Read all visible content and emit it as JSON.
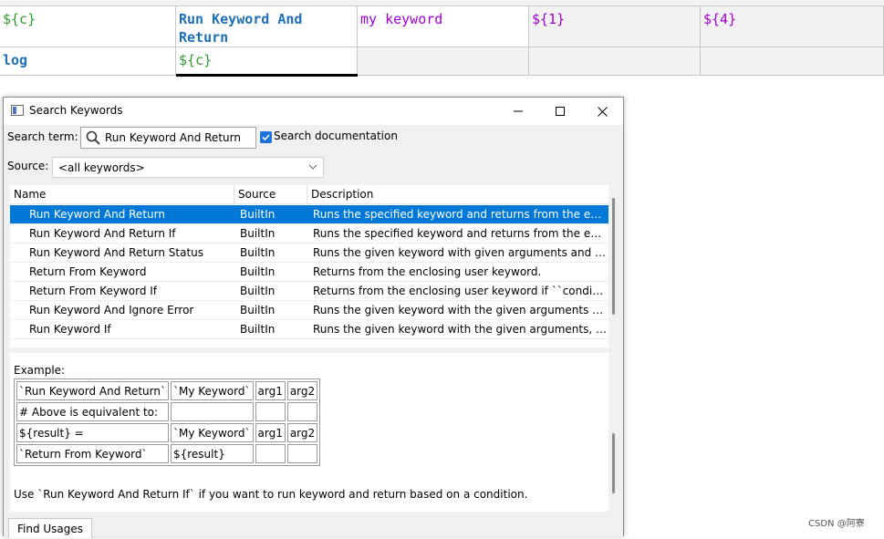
{
  "grid": {
    "row1": [
      "${c}",
      "Run Keyword And Return",
      "my keyword",
      "${1}",
      "${4}"
    ],
    "row2": [
      "log",
      "${c}",
      "",
      "",
      ""
    ]
  },
  "dialog": {
    "title": "Search Keywords",
    "search_term_label": "Search term:",
    "search_value": "Run Keyword And Return",
    "search_doc_label": "Search documentation",
    "search_doc_checked": true,
    "source_label": "Source:",
    "source_value": "<all keywords>",
    "columns": [
      "Name",
      "Source",
      "Description"
    ],
    "rows": [
      {
        "name": "Run Keyword And Return",
        "source": "BuiltIn",
        "desc": "Runs the specified keyword and returns from the enc...",
        "selected": true
      },
      {
        "name": "Run Keyword And Return If",
        "source": "BuiltIn",
        "desc": "Runs the specified keyword and returns from the enc..."
      },
      {
        "name": "Run Keyword And Return Status",
        "source": "BuiltIn",
        "desc": "Runs the given keyword with given arguments and re..."
      },
      {
        "name": "Return From Keyword",
        "source": "BuiltIn",
        "desc": "Returns from the enclosing user keyword."
      },
      {
        "name": "Return From Keyword If",
        "source": "BuiltIn",
        "desc": "Returns from the enclosing user keyword if ``conditio..."
      },
      {
        "name": "Run Keyword And Ignore Error",
        "source": "BuiltIn",
        "desc": "Runs the given keyword with the given arguments an..."
      },
      {
        "name": "Run Keyword If",
        "source": "BuiltIn",
        "desc": "Runs the given keyword with the given arguments, if ..."
      }
    ],
    "doc": {
      "example_label": "Example:",
      "table": [
        [
          "`Run Keyword And Return`",
          "`My Keyword`",
          "arg1",
          "arg2"
        ],
        [
          "# Above is equivalent to:",
          "",
          "",
          ""
        ],
        [
          "${result} =",
          "`My Keyword`",
          "arg1",
          "arg2"
        ],
        [
          "`Return From Keyword`",
          "${result}",
          "",
          ""
        ]
      ],
      "note": "Use `Run Keyword And Return If` if you want to run keyword and return based on a condition."
    },
    "find_usages_label": "Find Usages"
  },
  "watermark": "CSDN @阿寮",
  "colors": {
    "selection": "#0078d7",
    "checkbox": "#1a73d9",
    "grid_green": "#2e9a2e",
    "grid_blue": "#1e6fb8",
    "grid_purple": "#a000d0"
  }
}
